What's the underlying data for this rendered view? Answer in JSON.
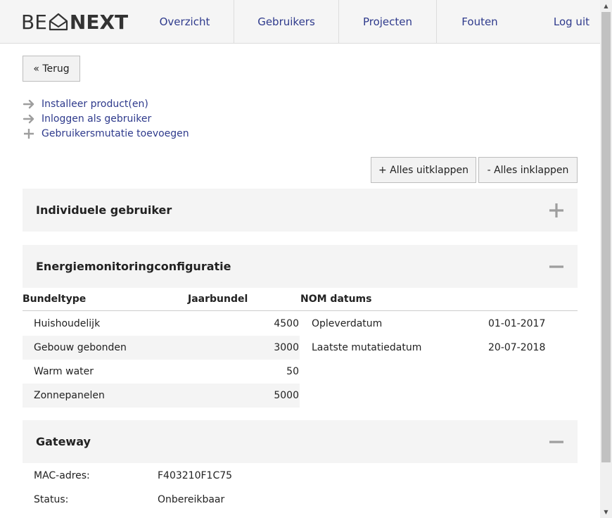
{
  "header": {
    "logo_left": "BE",
    "logo_right": "NEXT",
    "nav": [
      "Overzicht",
      "Gebruikers",
      "Projecten",
      "Fouten"
    ],
    "logout": "Log uit"
  },
  "back_button": "« Terug",
  "actions": [
    {
      "icon": "arrow-right-icon",
      "label": "Installeer product(en)"
    },
    {
      "icon": "arrow-right-icon",
      "label": "Inloggen als gebruiker"
    },
    {
      "icon": "plus-icon",
      "label": "Gebruikersmutatie toevoegen"
    }
  ],
  "expand_all": "+ Alles uitklappen",
  "collapse_all": "- Alles inklappen",
  "sections": {
    "individual": {
      "title": "Individuele gebruiker",
      "state": "collapsed"
    },
    "energy": {
      "title": "Energiemonitoringconfiguratie",
      "state": "expanded"
    },
    "gateway": {
      "title": "Gateway",
      "state": "expanded"
    }
  },
  "energy_table": {
    "headers": [
      "Bundeltype",
      "Jaarbundel",
      "NOM datums"
    ],
    "rows": [
      {
        "type": "Huishoudelijk",
        "value": "4500"
      },
      {
        "type": "Gebouw gebonden",
        "value": "3000"
      },
      {
        "type": "Warm water",
        "value": "50"
      },
      {
        "type": "Zonnepanelen",
        "value": "5000"
      }
    ],
    "nom": [
      {
        "label": "Opleverdatum",
        "date": "01-01-2017"
      },
      {
        "label": "Laatste mutatiedatum",
        "date": "20-07-2018"
      }
    ]
  },
  "gateway": {
    "rows": [
      {
        "label": "MAC-adres:",
        "value": "F403210F1C75"
      },
      {
        "label": "Status:",
        "value": "Onbereikbaar"
      }
    ]
  },
  "colors": {
    "link": "#2e3a8c",
    "section_bg": "#f4f4f4",
    "icon_gray": "#9e9e9e"
  }
}
